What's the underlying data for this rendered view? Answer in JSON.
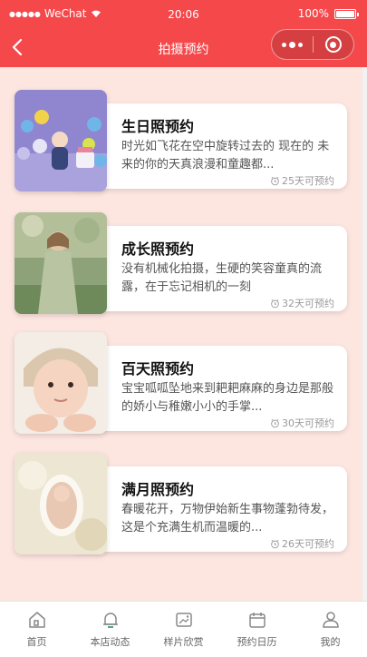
{
  "status_bar": {
    "carrier": "WeChat",
    "time": "20:06",
    "battery": "100%"
  },
  "navbar": {
    "title": "拍摄预约"
  },
  "cards": [
    {
      "title": "生日照预约",
      "description": "时光如飞花在空中旋转过去的 现在的 未来的你的天真浪漫和童趣都...",
      "availability": "25天可预约",
      "image": "birthday-photo"
    },
    {
      "title": "成长照预约",
      "description": "没有机械化拍摄，生硬的笑容童真的流露，在于忘记相机的一刻",
      "availability": "32天可预约",
      "image": "growth-photo"
    },
    {
      "title": "百天照预约",
      "description": "宝宝呱呱坠地来到耙耙麻麻的身边是那般的娇小与稚嫩小小的手掌...",
      "availability": "30天可预约",
      "image": "hundred-day-photo"
    },
    {
      "title": "满月照预约",
      "description": "春暖花开，万物伊始新生事物蓬勃待发，这是个充满生机而温暖的...",
      "availability": "26天可预约",
      "image": "full-month-photo"
    }
  ],
  "tabbar": [
    {
      "label": "首页",
      "icon": "home-icon"
    },
    {
      "label": "本店动态",
      "icon": "bell-icon"
    },
    {
      "label": "样片欣赏",
      "icon": "picture-icon"
    },
    {
      "label": "预约日历",
      "icon": "calendar-icon"
    },
    {
      "label": "我的",
      "icon": "user-icon"
    }
  ],
  "colors": {
    "accent": "#f4484b",
    "background": "#fde5e0"
  }
}
